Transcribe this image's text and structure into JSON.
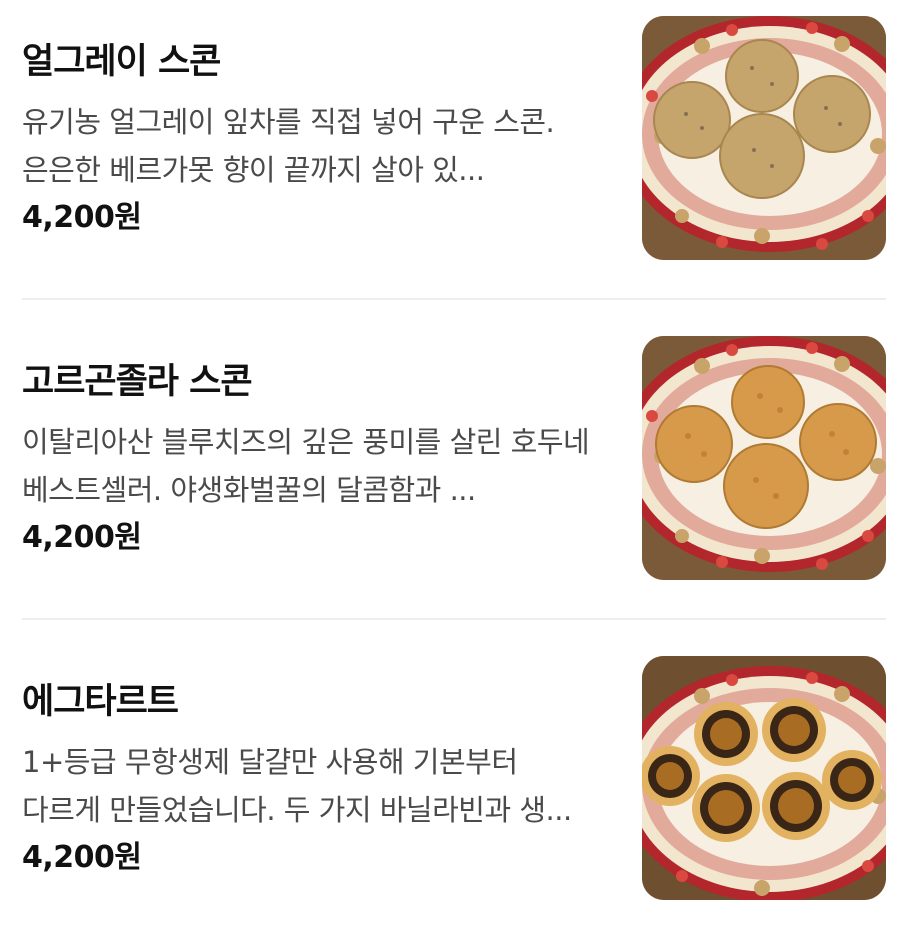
{
  "menu": {
    "items": [
      {
        "name": "얼그레이 스콘",
        "description": "유기농 얼그레이 잎차를 직접 넣어 구운 스콘. 은은한 베르가못 향이 끝까지 살아 있...",
        "price": "4,200원",
        "image_icon": "earl-grey-scone-photo"
      },
      {
        "name": "고르곤졸라 스콘",
        "description": "이탈리아산 블루치즈의 깊은 풍미를 살린 호두네 베스트셀러. 야생화벌꿀의 달콤함과 ...",
        "price": "4,200원",
        "image_icon": "gorgonzola-scone-photo"
      },
      {
        "name": "에그타르트",
        "description": "1+등급 무항생제 달걀만 사용해 기본부터 다르게 만들었습니다. 두 가지 바닐라빈과 생...",
        "price": "4,200원",
        "image_icon": "egg-tart-photo"
      }
    ]
  },
  "colors": {
    "text_primary": "#111111",
    "text_secondary": "#4a4a4a",
    "divider": "#eeeeee",
    "plate_rim_red": "#b3262b",
    "plate_cream": "#f3e6cf"
  }
}
